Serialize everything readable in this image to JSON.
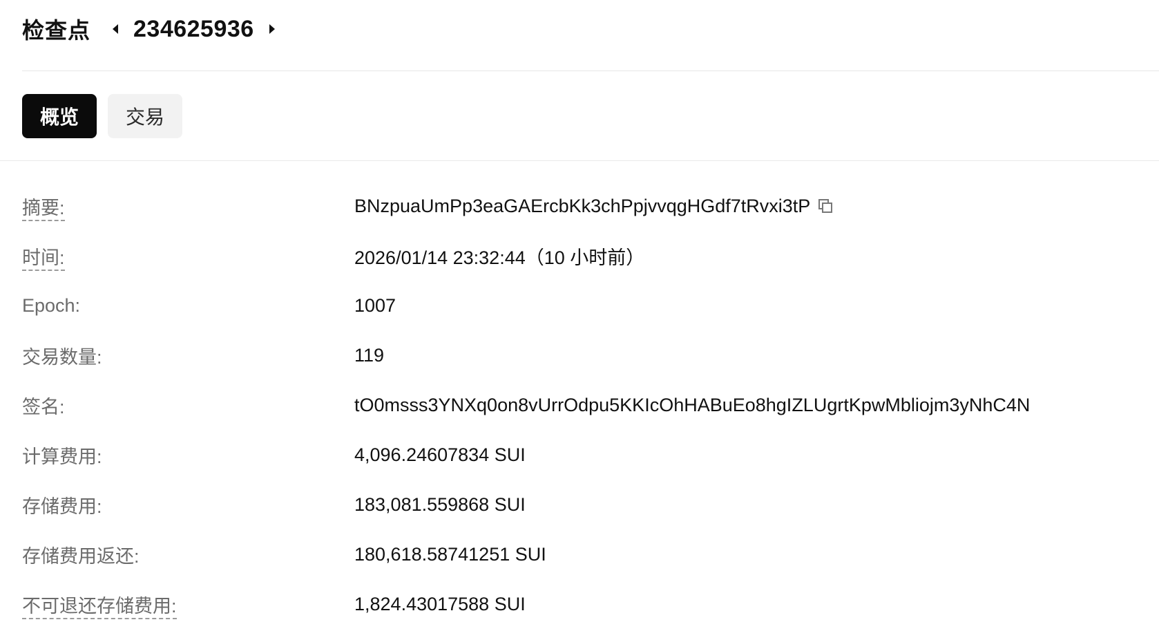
{
  "header": {
    "title": "检查点",
    "checkpoint_id": "234625936",
    "prev_icon": "caret-left-icon",
    "next_icon": "caret-right-icon"
  },
  "tabs": [
    {
      "label": "概览",
      "active": true
    },
    {
      "label": "交易",
      "active": false
    }
  ],
  "details": [
    {
      "label": "摘要:",
      "value": "BNzpuaUmPp3eaGAErcbKk3chPpjvvqgHGdf7tRvxi3tP",
      "dashed": true,
      "copy_icon": "copy-icon"
    },
    {
      "label": "时间:",
      "value": "2026/01/14 23:32:44（10 小时前）",
      "dashed": true
    },
    {
      "label": "Epoch:",
      "value": "1007",
      "dashed": false
    },
    {
      "label": "交易数量:",
      "value": "119",
      "dashed": false
    },
    {
      "label": "签名:",
      "value": "tO0msss3YNXq0on8vUrrOdpu5KKIcOhHABuEo8hgIZLUgrtKpwMbliojm3yNhC4N",
      "dashed": false
    },
    {
      "label": "计算费用:",
      "value": "4,096.24607834 SUI",
      "dashed": false
    },
    {
      "label": "存储费用:",
      "value": "183,081.559868 SUI",
      "dashed": false
    },
    {
      "label": "存储费用返还:",
      "value": "180,618.58741251 SUI",
      "dashed": false
    },
    {
      "label": "不可退还存储费用:",
      "value": "1,824.43017588 SUI",
      "dashed": true
    }
  ]
}
